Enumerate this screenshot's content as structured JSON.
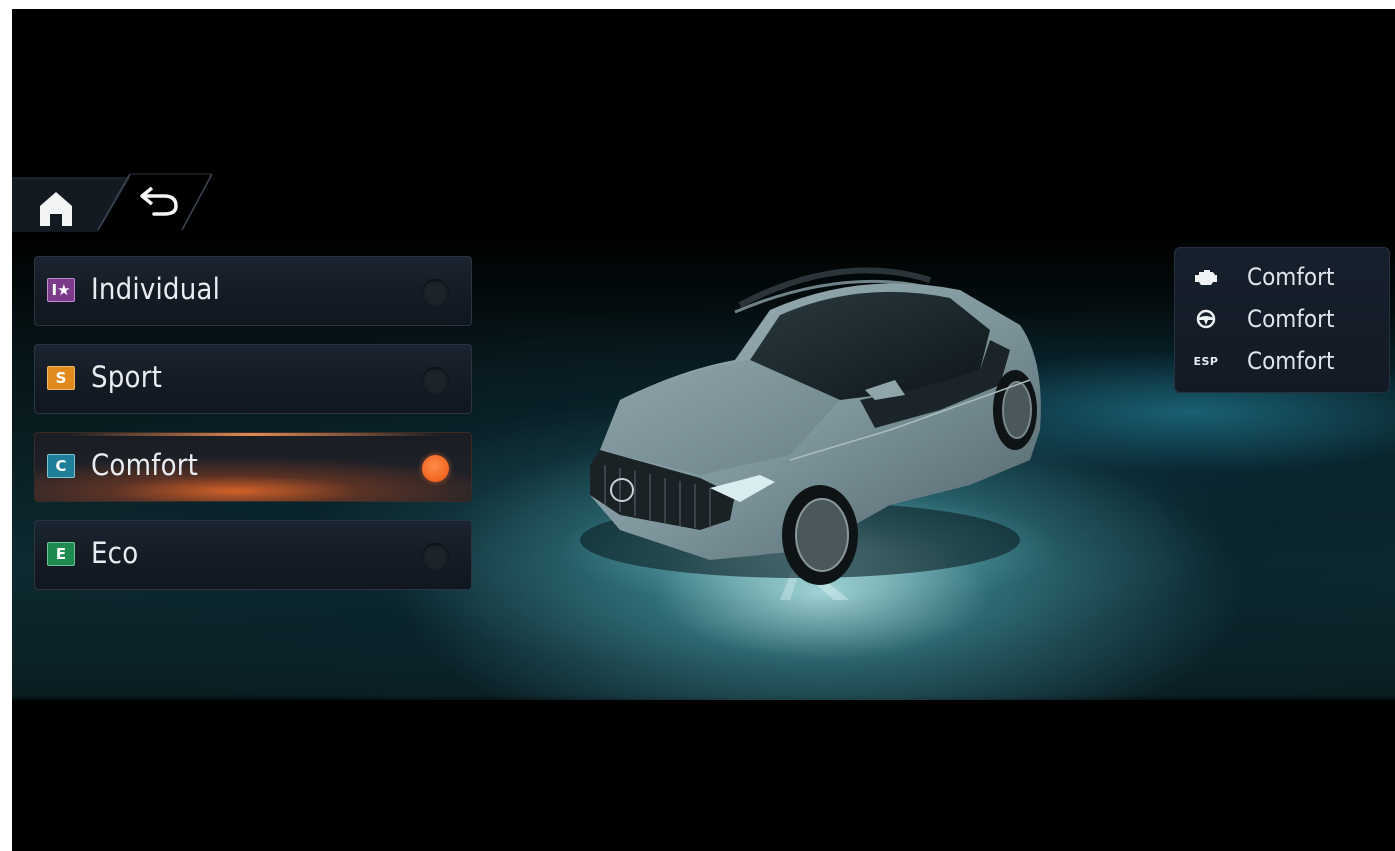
{
  "nav": {
    "home_icon": "home-icon",
    "back_icon": "back-arrow-icon"
  },
  "modes": [
    {
      "badge": "I★",
      "label": "Individual",
      "badge_color": "#7b3a8a",
      "selected": false
    },
    {
      "badge": "S",
      "label": "Sport",
      "badge_color": "#e08a1e",
      "selected": false
    },
    {
      "badge": "C",
      "label": "Comfort",
      "badge_color": "#1f7f98",
      "selected": true
    },
    {
      "badge": "E",
      "label": "Eco",
      "badge_color": "#1f8a4f",
      "selected": false
    }
  ],
  "info_panel": {
    "rows": [
      {
        "icon": "engine-icon",
        "value": "Comfort"
      },
      {
        "icon": "steering-wheel-icon",
        "value": "Comfort"
      },
      {
        "icon": "esp-icon",
        "icon_text": "ESP",
        "value": "Comfort"
      }
    ]
  },
  "colors": {
    "accent": "#f26c28",
    "background": "#000000",
    "glow": "#9fe0e0"
  }
}
